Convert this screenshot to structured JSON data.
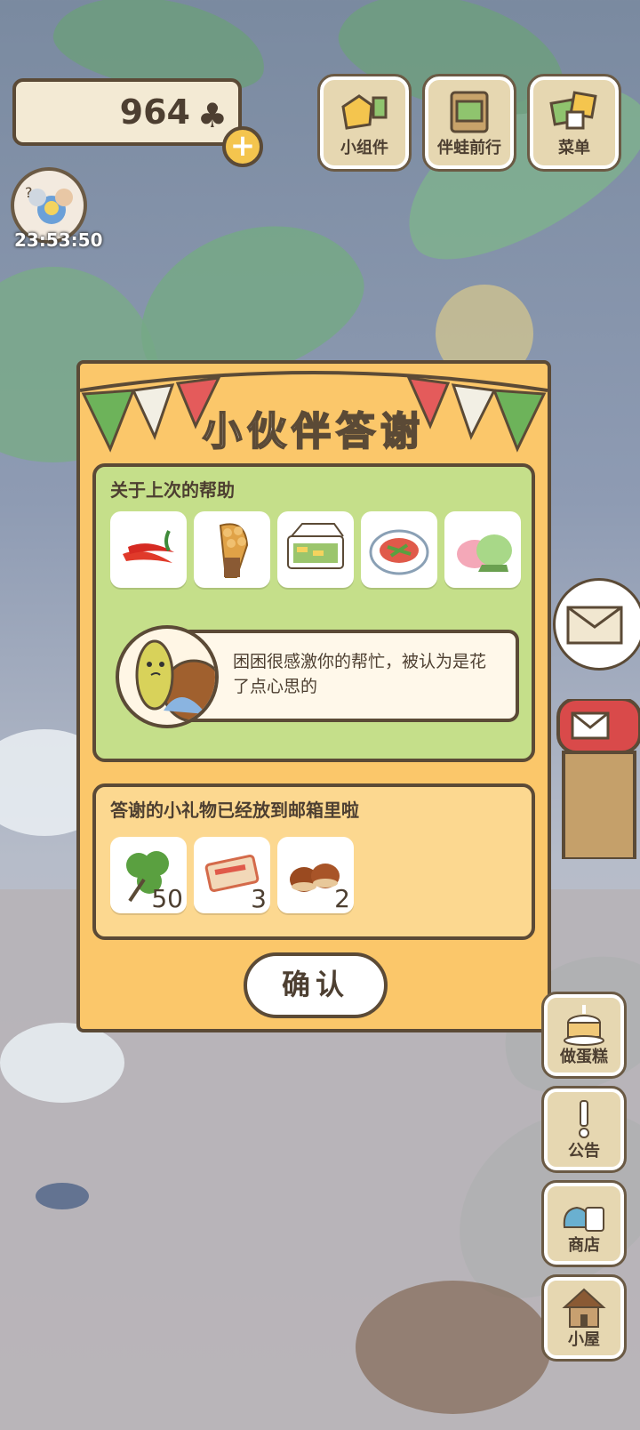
{
  "header": {
    "clover_count": "964",
    "clover_icon": "♣",
    "plus_label": "+",
    "timer": "23:53:50"
  },
  "top_buttons": [
    {
      "label": "小组件",
      "icon": "widget-icon"
    },
    {
      "label": "伴蛙前行",
      "icon": "journey-icon"
    },
    {
      "label": "菜单",
      "icon": "menu-icon"
    }
  ],
  "dialog": {
    "title": "小伙伴答谢",
    "help_section": {
      "title": "关于上次的帮助",
      "items": [
        "chili-pepper-icon",
        "egg-waffle-icon",
        "bento-box-icon",
        "salad-plate-icon",
        "mochi-icon"
      ],
      "message": "困困很感激你的帮忙，被认为是花了点心思的"
    },
    "gift_section": {
      "title": "答谢的小礼物已经放到邮箱里啦",
      "gifts": [
        {
          "icon": "clover-icon",
          "count": "50"
        },
        {
          "icon": "ticket-icon",
          "count": "3"
        },
        {
          "icon": "chestnut-icon",
          "count": "2"
        }
      ]
    },
    "confirm_label": "确认"
  },
  "side_buttons": [
    {
      "label": "做蛋糕",
      "icon": "cake-icon"
    },
    {
      "label": "公告",
      "icon": "notice-icon"
    },
    {
      "label": "商店",
      "icon": "shop-icon"
    },
    {
      "label": "小屋",
      "icon": "house-icon"
    }
  ],
  "colors": {
    "dialog_bg": "#fbc76a",
    "panel_green": "#c5df8a",
    "outline_brown": "#5b4a36",
    "button_tan": "#e6d7b1"
  }
}
